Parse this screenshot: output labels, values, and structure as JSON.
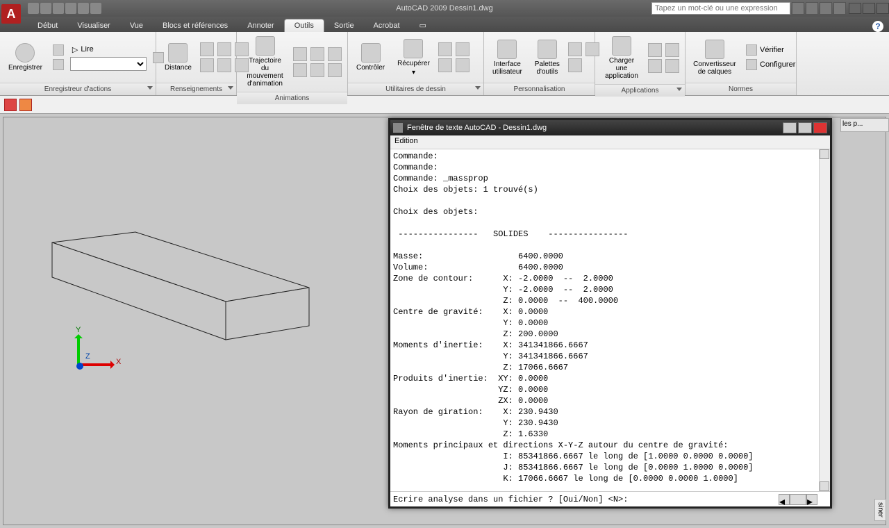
{
  "app": {
    "title_prefix": "AutoCAD 2009",
    "document": "Dessin1.dwg",
    "search_placeholder": "Tapez un mot-clé ou une expression"
  },
  "tabs": {
    "items": [
      "Début",
      "Visualiser",
      "Vue",
      "Blocs et références",
      "Annoter",
      "Outils",
      "Sortie",
      "Acrobat"
    ],
    "active_index": 5
  },
  "ribbon": {
    "panel0": {
      "title": "Enregistreur d'actions",
      "record": "Enregistrer",
      "play": "Lire"
    },
    "panel1": {
      "title": "Renseignements",
      "distance": "Distance"
    },
    "panel2": {
      "title": "Animations",
      "traj": "Trajectoire du mouvement d'animation"
    },
    "panel3": {
      "title": "Utilitaires de dessin",
      "controller": "Contrôler",
      "recuperer": "Récupérer"
    },
    "panel4": {
      "title": "Personnalisation",
      "iu": "Interface utilisateur",
      "palettes": "Palettes d'outils"
    },
    "panel5": {
      "title": "Applications",
      "charger": "Charger une application"
    },
    "panel6": {
      "title": "Normes",
      "convert": "Convertisseur de calques",
      "verifier": "Vérifier",
      "configurer": "Configurer"
    }
  },
  "text_window": {
    "title": "Fenêtre de texte AutoCAD - Dessin1.dwg",
    "menu": "Edition",
    "body": "Commande:\nCommande:\nCommande: _massprop\nChoix des objets: 1 trouvé(s)\n\nChoix des objets:\n\n ----------------   SOLIDES    ----------------\n\nMasse:                   6400.0000\nVolume:                  6400.0000\nZone de contour:      X: -2.0000  --  2.0000\n                      Y: -2.0000  --  2.0000\n                      Z: 0.0000  --  400.0000\nCentre de gravité:    X: 0.0000\n                      Y: 0.0000\n                      Z: 200.0000\nMoments d'inertie:    X: 341341866.6667\n                      Y: 341341866.6667\n                      Z: 17066.6667\nProduits d'inertie:  XY: 0.0000\n                     YZ: 0.0000\n                     ZX: 0.0000\nRayon de giration:    X: 230.9430\n                      Y: 230.9430\n                      Z: 1.6330\nMoments principaux et directions X-Y-Z autour du centre de gravité:\n                      I: 85341866.6667 le long de [1.0000 0.0000 0.0000]\n                      J: 85341866.6667 le long de [0.0000 1.0000 0.0000]\n                      K: 17066.6667 le long de [0.0000 0.0000 1.0000]",
    "prompt": "Ecrire analyse dans un fichier ? [Oui/Non] <N>:"
  },
  "side": {
    "tab1": "les p...",
    "tab2": "siner"
  },
  "axis": {
    "x": "X",
    "y": "Y",
    "z": "Z"
  }
}
